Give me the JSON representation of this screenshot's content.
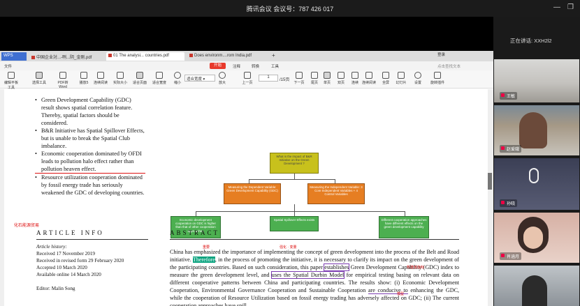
{
  "meeting": {
    "title": "腾讯会议 会议号：787 426 017",
    "speaking_label": "正在讲话: XXH2l2"
  },
  "tabs": [
    {
      "label": "WPS"
    },
    {
      "label": "中国企业対...-咧...阴_金刚.pdf"
    },
    {
      "label": "01 The analysi... countries.pdf"
    },
    {
      "label": "Does environm....rom India.pdf"
    }
  ],
  "menubar": {
    "file": "文件",
    "tab_start": "开始",
    "annotate": "注释",
    "convert": "转换",
    "tools": "工具",
    "search": "点击查找文本",
    "login": "登录"
  },
  "toolbar": [
    {
      "label": "编辑平板工具"
    },
    {
      "label": "选择工具"
    },
    {
      "label": "PDF转Word"
    },
    {
      "label": "播放5"
    },
    {
      "label": "连续阅读"
    },
    {
      "label": "实际大小"
    },
    {
      "label": "适合页面"
    },
    {
      "label": "适合宽度"
    },
    {
      "label": "缩小"
    },
    {
      "label": "适合宽度"
    },
    {
      "label": "放大"
    },
    {
      "label": "上一页"
    },
    {
      "label": "下一页"
    },
    {
      "label": "尾页"
    },
    {
      "label": "单页"
    },
    {
      "label": "双页"
    },
    {
      "label": "连续"
    },
    {
      "label": "连续阅读"
    },
    {
      "label": "全屏"
    },
    {
      "label": "幻灯片"
    },
    {
      "label": "设置"
    },
    {
      "label": "旋转插件"
    }
  ],
  "page_nav": {
    "current": "1",
    "total": "/15页"
  },
  "bullets": [
    "Green Development Capability (GDC) result shows spatial correlation feature. Thereby, spatial factors should be considered.",
    "B&R Initiative has Spatial Spillover Effects, but is unable to break the Spatial Club imbalance.",
    "Economic cooperation dominated by OFDI leads to pollution halo effect rather than pollution heaven effect.",
    "Resource utilization cooperation dominated by fossil energy trade has seriously weakened the GDC of developing countries."
  ],
  "side_note": "化石能源贸易",
  "diagram": {
    "root": "What is the impact of B&R Initiative on the Green Development ?",
    "mid_left": "Measuring the Dependent Variable: Green Development Capability (GDC)",
    "mid_right": "Measuring the Independent Variable: 3 Core Independent Variables + 4 Control Variables",
    "leaf_1": "Economic development cooperation on GDC is higher than that of other cooperation approaches",
    "leaf_2": "Spatial Spillover Effects exists",
    "leaf_3": "Different cooperation approaches have different effects on the green development capability"
  },
  "article_info": {
    "heading": "ARTICLE INFO",
    "history_label": "Article history:",
    "received": "Received 17 November 2019",
    "revised": "Received in revised form 29 February 2020",
    "accepted": "Accepted 10 March 2020",
    "online": "Available online 14 March 2020",
    "editor": "Editor: Malin Song"
  },
  "abstract": {
    "heading": "ABSTRACT",
    "text_1": "China has emphasized the importance of implementing the concept of green development into the process of the Belt and Road initiative. ",
    "therefore": "Therefore",
    "text_2": ", in the process of promoting the initiative, it is necessary to clarify its impact on the green development of the participating countries. Based on such consideration, this paper ",
    "establishes": "establishes",
    "text_3": " Green Development Capability (GDC) index to measure the green development level, and ",
    "durbin": "uses the Spatial Durbin Model",
    "text_4": " for empirical testing basing on relevant data on different cooperative patterns between China and participating countries. The results show: (i) Economic Development Cooperation, Environmental Governance Cooperation and Sustainable Cooperation ",
    "conducive": "are conducive to",
    "text_5": " enhancing the GDC, while the cooperation of Resource Utilization based on fossil energy trading has adversely affected on GDC; (ii) The current cooperation approaches have spill"
  },
  "annotations": {
    "a1": "重要",
    "a2": "强化 · 变量",
    "a3": "构建该指标",
    "a4": "模型"
  },
  "participants": [
    {
      "name": "王敏"
    },
    {
      "name": "赵爱娥"
    },
    {
      "name": "孙晓"
    },
    {
      "name": "肖涵月"
    }
  ]
}
